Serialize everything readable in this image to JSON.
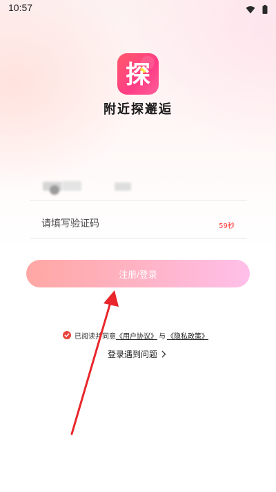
{
  "status_bar": {
    "time": "10:57",
    "icons": [
      "wifi-icon",
      "battery-icon"
    ]
  },
  "app": {
    "logo_char": "探",
    "name": "附近探邂逅",
    "logo_gradient": [
      "#ff5a6a",
      "#ff3d86"
    ]
  },
  "login_form": {
    "code_placeholder": "请填写验证码",
    "countdown": "59秒",
    "submit_label": "注册/登录"
  },
  "agreement": {
    "prefix": "已阅读并同意",
    "user_agreement": "《用户协议》",
    "joiner": "与",
    "privacy_policy": "《隐私政策》"
  },
  "help": {
    "label": "登录遇到问题"
  },
  "colors": {
    "accent_red": "#ff3b3b",
    "check_red": "#e8443b",
    "button_gradient": [
      "#ffa7a4",
      "#ffbfe9"
    ],
    "annotation_arrow": "#e8262b"
  }
}
